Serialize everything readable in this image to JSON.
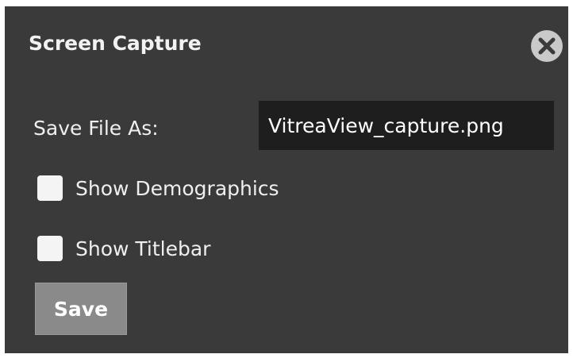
{
  "dialog": {
    "title": "Screen Capture",
    "close_icon": "close-icon",
    "save_file": {
      "label": "Save File As:",
      "value": "VitreaView_capture.png"
    },
    "options": [
      {
        "label": "Show Demographics",
        "checked": false
      },
      {
        "label": "Show Titlebar",
        "checked": false
      }
    ],
    "save_label": "Save"
  },
  "colors": {
    "dialog_bg": "#3a3a3a",
    "input_bg": "#1e1e1e",
    "button_bg": "#8a8a8a",
    "close_bg": "#c9c9c9"
  }
}
